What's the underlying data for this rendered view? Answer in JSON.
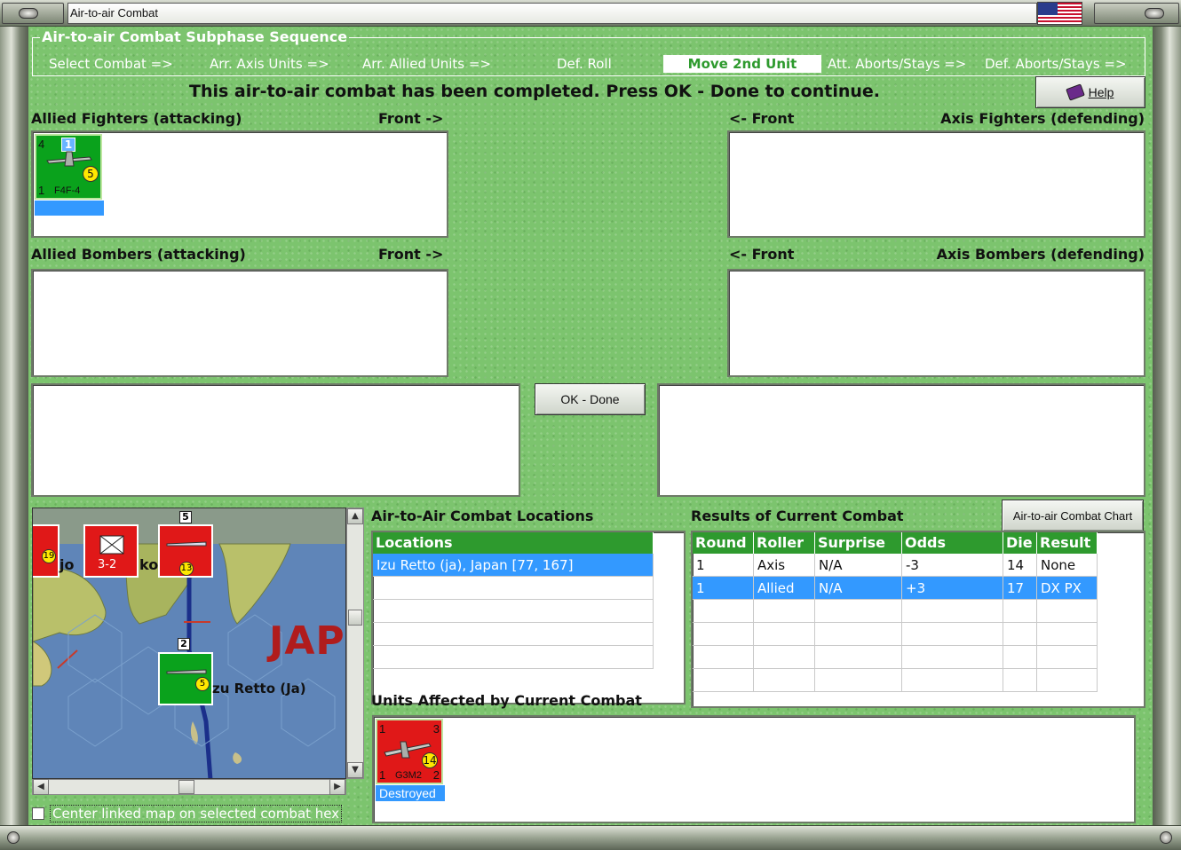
{
  "window": {
    "title": "Air-to-air Combat"
  },
  "sequence": {
    "title": "Air-to-air Combat Subphase Sequence",
    "steps": [
      "Select Combat =>",
      "Arr. Axis Units =>",
      "Arr. Allied Units =>",
      "Def. Roll",
      "Move 2nd Unit",
      "Att. Aborts/Stays =>",
      "Def. Aborts/Stays =>"
    ],
    "active_index": 4
  },
  "status_message": "This air-to-air combat has been completed.  Press OK - Done to continue.",
  "help_button": "Help",
  "panels": {
    "allied_fighters": "Allied Fighters (attacking)",
    "axis_fighters": "Axis Fighters (defending)",
    "allied_bombers": "Allied Bombers (attacking)",
    "axis_bombers": "Axis Bombers (defending)",
    "front_right": "Front ->",
    "front_left": "<- Front"
  },
  "allied_fighter_unit": {
    "model": "F4F-4",
    "attack": "4",
    "range": "1",
    "badge": "1",
    "strength": "5"
  },
  "ok_button": "OK - Done",
  "map": {
    "place_label": "zu Retto (Ja)",
    "region_label": "JAP",
    "fragments": [
      "jo",
      "ko"
    ],
    "hex_counts": [
      "5",
      "2"
    ],
    "unit_values": [
      "19",
      "3-2",
      "13",
      "5"
    ]
  },
  "center_checkbox": "Center linked map on selected combat hex",
  "locations": {
    "title": "Air-to-Air Combat Locations",
    "header": "Locations",
    "rows": [
      "Izu Retto (ja), Japan [77, 167]"
    ]
  },
  "results": {
    "title": "Results of Current Combat",
    "chart_button": "Air-to-air Combat Chart",
    "columns": [
      "Round",
      "Roller",
      "Surprise",
      "Odds",
      "Die",
      "Result"
    ],
    "rows": [
      [
        "1",
        "Axis",
        "N/A",
        "-3",
        "14",
        "None"
      ],
      [
        "1",
        "Allied",
        "N/A",
        "+3",
        "17",
        "DX PX"
      ]
    ],
    "selected_row": 1
  },
  "affected": {
    "title": "Units Affected by Current Combat",
    "unit": {
      "model": "G3M2",
      "top_left": "1",
      "top_right": "3",
      "bottom_left": "1",
      "bottom_right": "2",
      "strength": "14",
      "status": "Destroyed"
    }
  },
  "colors": {
    "panel_green": "#7cc46e",
    "header_green": "#2e9a2e",
    "selection_blue": "#3399ff",
    "axis_red": "#e01818",
    "allied_green": "#0aa21c"
  }
}
